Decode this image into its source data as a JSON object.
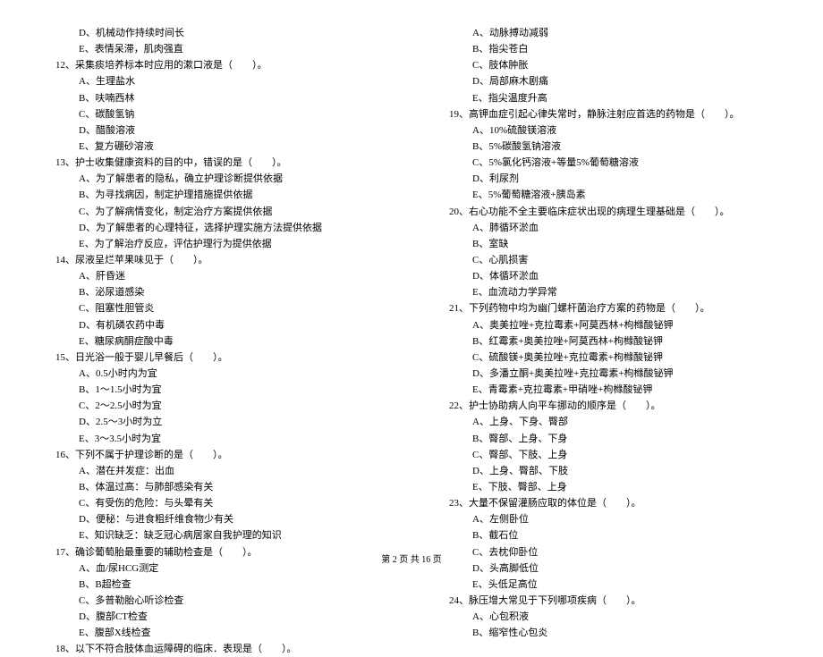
{
  "left": [
    {
      "cls": "option",
      "text": "D、机械动作持续时间长"
    },
    {
      "cls": "option",
      "text": "E、表情呆滞，肌肉强直"
    },
    {
      "cls": "question",
      "text": "12、采集痰培养标本时应用的漱口液是（　　）。"
    },
    {
      "cls": "option",
      "text": "A、生理盐水"
    },
    {
      "cls": "option",
      "text": "B、呋喃西林"
    },
    {
      "cls": "option",
      "text": "C、碳酸氢钠"
    },
    {
      "cls": "option",
      "text": "D、醋酸溶液"
    },
    {
      "cls": "option",
      "text": "E、复方硼砂溶液"
    },
    {
      "cls": "question",
      "text": "13、护士收集健康资料的目的中，错误的是（　　）。"
    },
    {
      "cls": "option",
      "text": "A、为了解患者的隐私，确立护理诊断提供依据"
    },
    {
      "cls": "option",
      "text": "B、为寻找病因，制定护理措施提供依据"
    },
    {
      "cls": "option",
      "text": "C、为了解病情变化，制定治疗方案提供依据"
    },
    {
      "cls": "option",
      "text": "D、为了解患者的心理特征，选择护理实施方法提供依据"
    },
    {
      "cls": "option",
      "text": "E、为了解治疗反应，评估护理行为提供依据"
    },
    {
      "cls": "question",
      "text": "14、尿液呈烂苹果味见于（　　）。"
    },
    {
      "cls": "option",
      "text": "A、肝昏迷"
    },
    {
      "cls": "option",
      "text": "B、泌尿道感染"
    },
    {
      "cls": "option",
      "text": "C、阻塞性胆管炎"
    },
    {
      "cls": "option",
      "text": "D、有机磷农药中毒"
    },
    {
      "cls": "option",
      "text": "E、糖尿病酮症酸中毒"
    },
    {
      "cls": "question",
      "text": "15、日光浴一般于婴儿早餐后（　　）。"
    },
    {
      "cls": "option",
      "text": "A、0.5小时内为宜"
    },
    {
      "cls": "option",
      "text": "B、1～1.5小时为宜"
    },
    {
      "cls": "option",
      "text": "C、2～2.5小时为宜"
    },
    {
      "cls": "option",
      "text": "D、2.5～3小时为立"
    },
    {
      "cls": "option",
      "text": "E、3～3.5小时为宜"
    },
    {
      "cls": "question",
      "text": "16、下列不属于护理诊断的是（　　）。"
    },
    {
      "cls": "option",
      "text": "A、潜在并发症：出血"
    },
    {
      "cls": "option",
      "text": "B、体温过高：与肺部感染有关"
    },
    {
      "cls": "option",
      "text": "C、有受伤的危险：与头晕有关"
    },
    {
      "cls": "option",
      "text": "D、便秘：与进食粗纤维食物少有关"
    },
    {
      "cls": "option",
      "text": "E、知识缺乏：缺乏冠心病居家自我护理的知识"
    },
    {
      "cls": "question",
      "text": "17、确诊葡萄胎最重要的辅助检查是（　　）。"
    },
    {
      "cls": "option",
      "text": "A、血/尿HCG测定"
    },
    {
      "cls": "option",
      "text": "B、B超检查"
    },
    {
      "cls": "option",
      "text": "C、多普勒胎心听诊检查"
    },
    {
      "cls": "option",
      "text": "D、腹部CT检查"
    },
    {
      "cls": "option",
      "text": "E、腹部X线检查"
    },
    {
      "cls": "question",
      "text": "18、以下不符合肢体血运障碍的临床．表现是（　　）。"
    }
  ],
  "right": [
    {
      "cls": "option",
      "text": "A、动脉搏动减弱"
    },
    {
      "cls": "option",
      "text": "B、指尖苍白"
    },
    {
      "cls": "option",
      "text": "C、肢体肿胀"
    },
    {
      "cls": "option",
      "text": "D、局部麻木剧痛"
    },
    {
      "cls": "option",
      "text": "E、指尖温度升高"
    },
    {
      "cls": "question",
      "text": "19、高钾血症引起心律失常时，静脉注射应首选的药物是（　　）。"
    },
    {
      "cls": "option",
      "text": "A、10%硫酸镁溶液"
    },
    {
      "cls": "option",
      "text": "B、5%碳酸氢钠溶液"
    },
    {
      "cls": "option",
      "text": "C、5%氯化钙溶液+等量5%葡萄糖溶液"
    },
    {
      "cls": "option",
      "text": "D、利尿剂"
    },
    {
      "cls": "option",
      "text": "E、5%葡萄糖溶液+胰岛素"
    },
    {
      "cls": "question",
      "text": "20、右心功能不全主要临床症状出现的病理生理基础是（　　）。"
    },
    {
      "cls": "option",
      "text": "A、肺循环淤血"
    },
    {
      "cls": "option",
      "text": "B、室缺"
    },
    {
      "cls": "option",
      "text": "C、心肌损害"
    },
    {
      "cls": "option",
      "text": "D、体循环淤血"
    },
    {
      "cls": "option",
      "text": "E、血流动力学异常"
    },
    {
      "cls": "question",
      "text": "21、下列药物中均为幽门螺杆菌治疗方案的药物是（　　）。"
    },
    {
      "cls": "option",
      "text": "A、奥美拉唑+克拉霉素+阿莫西林+枸橼酸铋钾"
    },
    {
      "cls": "option",
      "text": "B、红霉素+奥美拉唑+阿莫西林+枸橼酸铋钾"
    },
    {
      "cls": "option",
      "text": "C、硫酸镁+奥美拉唑+克拉霉素+枸橼酸铋钾"
    },
    {
      "cls": "option",
      "text": "D、多潘立酮+奥美拉唑+克拉霉素+枸橼酸铋钾"
    },
    {
      "cls": "option",
      "text": "E、青霉素+克拉霉素+甲硝唑+枸橼酸铋钾"
    },
    {
      "cls": "question",
      "text": "22、护士协助病人向平车挪动的顺序是（　　）。"
    },
    {
      "cls": "option",
      "text": "A、上身、下身、臀部"
    },
    {
      "cls": "option",
      "text": "B、臀部、上身、下身"
    },
    {
      "cls": "option",
      "text": "C、臀部、下肢、上身"
    },
    {
      "cls": "option",
      "text": "D、上身、臀部、下肢"
    },
    {
      "cls": "option",
      "text": "E、下肢、臀部、上身"
    },
    {
      "cls": "question",
      "text": "23、大量不保留灌肠应取的体位是（　　）。"
    },
    {
      "cls": "option",
      "text": "A、左侧卧位"
    },
    {
      "cls": "option",
      "text": "B、截石位"
    },
    {
      "cls": "option",
      "text": "C、去枕仰卧位"
    },
    {
      "cls": "option",
      "text": "D、头高脚低位"
    },
    {
      "cls": "option",
      "text": "E、头低足高位"
    },
    {
      "cls": "question",
      "text": "24、脉压增大常见于下列哪项疾病（　　）。"
    },
    {
      "cls": "option",
      "text": "A、心包积液"
    },
    {
      "cls": "option",
      "text": "B、缩窄性心包炎"
    }
  ],
  "footer": "第 2 页 共 16 页"
}
